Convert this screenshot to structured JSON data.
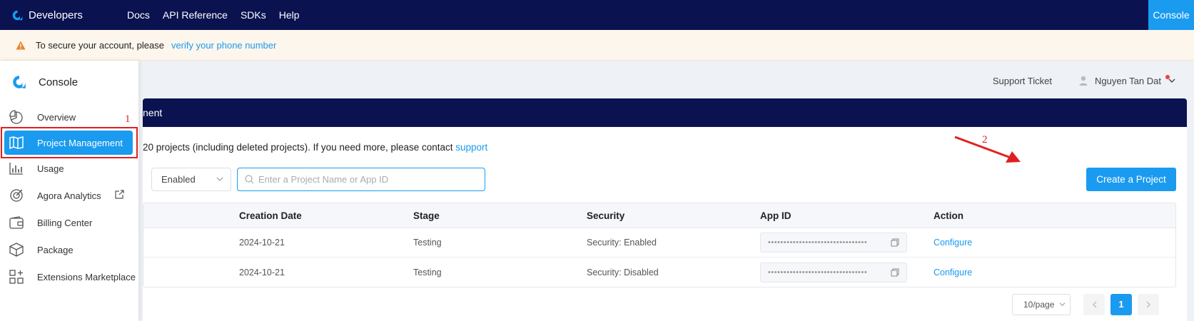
{
  "topnav": {
    "brand": "Developers",
    "links": [
      "Docs",
      "API Reference",
      "SDKs",
      "Help"
    ],
    "console": "Console"
  },
  "banner": {
    "text": "To secure your account, please",
    "link": "verify your phone number"
  },
  "header": {
    "support_ticket": "Support Ticket",
    "user_name": "Nguyen Tan Dat"
  },
  "sidebar": {
    "title": "Console",
    "items": [
      {
        "label": "Overview",
        "icon": "pie-chart-icon"
      },
      {
        "label": "Project Management",
        "icon": "map-icon",
        "active": true
      },
      {
        "label": "Usage",
        "icon": "bar-chart-icon"
      },
      {
        "label": "Agora Analytics",
        "icon": "analytics-icon",
        "external": true
      },
      {
        "label": "Billing Center",
        "icon": "wallet-icon"
      },
      {
        "label": "Package",
        "icon": "package-icon"
      },
      {
        "label": "Extensions Marketplace",
        "icon": "extensions-icon"
      }
    ]
  },
  "main": {
    "card_title": "nent",
    "notice_text": "20 projects (including deleted projects). If you need more, please contact",
    "notice_link": "support",
    "filter_value": "Enabled",
    "search_placeholder": "Enter a Project Name or App ID",
    "create_button": "Create a Project",
    "table": {
      "headers": [
        "Creation Date",
        "Stage",
        "Security",
        "App ID",
        "Action"
      ],
      "rows": [
        {
          "date": "2024-10-21",
          "stage": "Testing",
          "security": "Security: Enabled",
          "app_id": "••••••••••••••••••••••••••••••••",
          "action": "Configure"
        },
        {
          "date": "2024-10-21",
          "stage": "Testing",
          "security": "Security: Disabled",
          "app_id": "••••••••••••••••••••••••••••••••",
          "action": "Configure"
        }
      ]
    },
    "pagination": {
      "page_size": "10/page",
      "current_page": "1"
    }
  },
  "annotations": {
    "label_1": "1",
    "label_2": "2",
    "color": "#e02020"
  },
  "colors": {
    "nav_bg": "#0a1250",
    "accent": "#1a9bf0"
  }
}
